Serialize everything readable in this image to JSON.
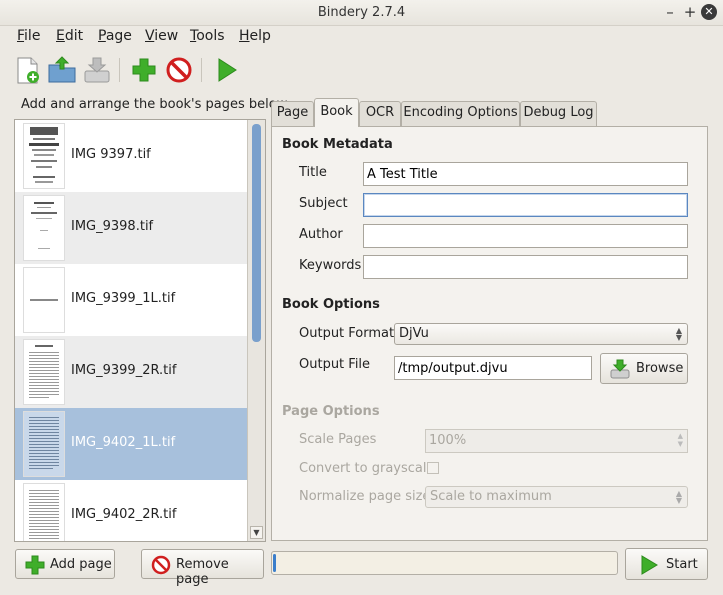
{
  "window": {
    "title": "Bindery 2.7.4"
  },
  "menu": [
    {
      "pre": "",
      "u": "F",
      "post": "ile"
    },
    {
      "pre": "",
      "u": "E",
      "post": "dit"
    },
    {
      "pre": "",
      "u": "P",
      "post": "age"
    },
    {
      "pre": "",
      "u": "V",
      "post": "iew"
    },
    {
      "pre": "",
      "u": "T",
      "post": "ools"
    },
    {
      "pre": "",
      "u": "H",
      "post": "elp"
    }
  ],
  "page_list": {
    "caption": "Add and arrange the book's pages below",
    "items": [
      {
        "name": "IMG 9397.tif"
      },
      {
        "name": "IMG_9398.tif"
      },
      {
        "name": "IMG_9399_1L.tif"
      },
      {
        "name": "IMG_9399_2R.tif"
      },
      {
        "name": "IMG_9402_1L.tif"
      },
      {
        "name": "IMG_9402_2R.tif"
      }
    ],
    "selected_index": 4
  },
  "buttons": {
    "add_page": "Add page",
    "remove_page": "Remove page",
    "start": "Start",
    "browse": "Browse"
  },
  "tabs": [
    "Page",
    "Book",
    "OCR",
    "Encoding Options",
    "Debug Log"
  ],
  "active_tab": "Book",
  "book_metadata": {
    "heading": "Book Metadata",
    "title_label": "Title",
    "title_value": "A Test Title",
    "subject_label": "Subject",
    "subject_value": "",
    "author_label": "Author",
    "author_value": "",
    "keywords_label": "Keywords",
    "keywords_value": ""
  },
  "book_options": {
    "heading": "Book Options",
    "format_label": "Output Format",
    "format_value": "DjVu",
    "file_label": "Output File",
    "file_value": "/tmp/output.djvu"
  },
  "page_options": {
    "heading": "Page Options",
    "scale_label": "Scale Pages",
    "scale_value": "100%",
    "grayscale_label": "Convert to grayscale",
    "normalize_label": "Normalize page size",
    "normalize_value": "Scale to maximum"
  },
  "colors": {
    "selection": "#a7c0dc",
    "accent": "#3b7ecb",
    "green": "#3fae2a",
    "red": "#d01f1f"
  }
}
